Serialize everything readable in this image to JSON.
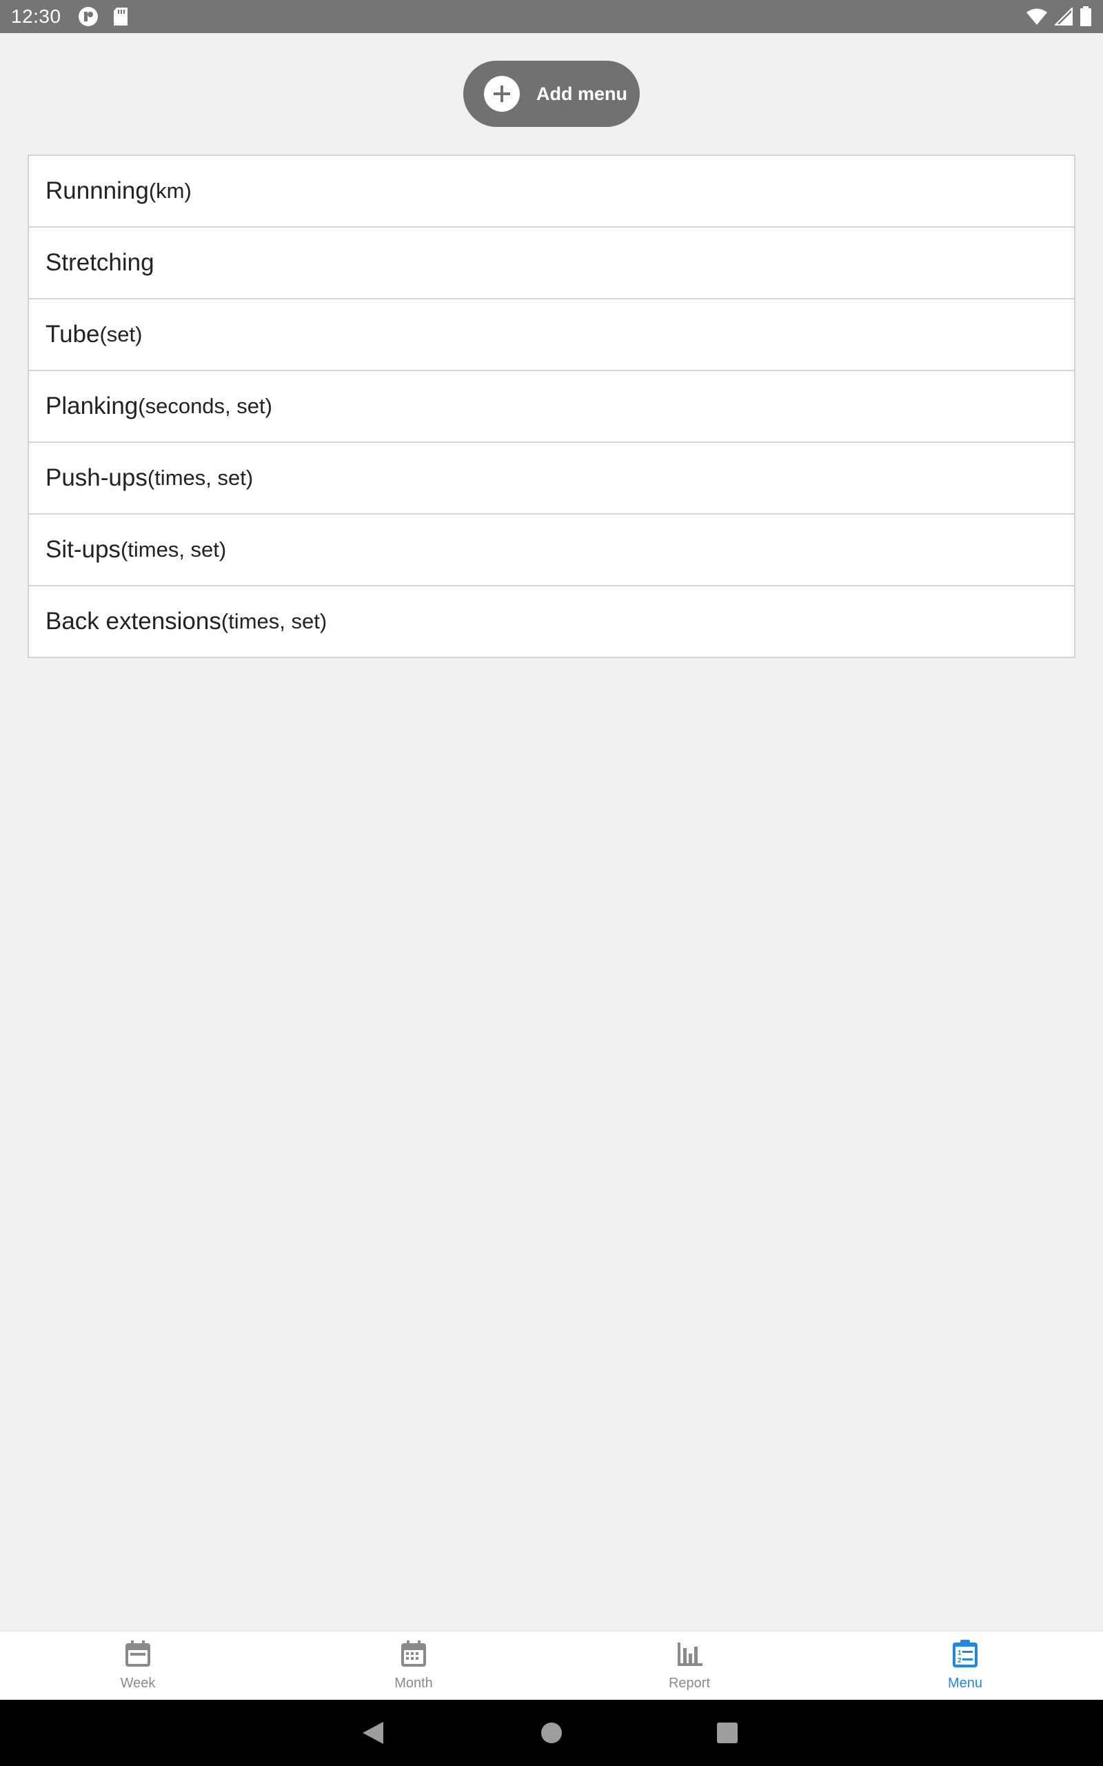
{
  "status_bar": {
    "time": "12:30"
  },
  "add_menu": {
    "label": "Add menu"
  },
  "exercises": [
    {
      "name": "Runnning",
      "unit": "(km)"
    },
    {
      "name": "Stretching",
      "unit": ""
    },
    {
      "name": "Tube",
      "unit": "(set)"
    },
    {
      "name": "Planking",
      "unit": "(seconds, set)"
    },
    {
      "name": "Push-ups",
      "unit": "(times, set)"
    },
    {
      "name": "Sit-ups",
      "unit": "(times, set)"
    },
    {
      "name": "Back extensions",
      "unit": "(times, set)"
    }
  ],
  "bottom_nav": {
    "active": "Menu",
    "active_color": "#1e88e5",
    "inactive_color": "#8a8a8a",
    "tabs": [
      {
        "label": "Week",
        "icon": "calendar-week-icon"
      },
      {
        "label": "Month",
        "icon": "calendar-month-icon"
      },
      {
        "label": "Report",
        "icon": "bar-chart-icon"
      },
      {
        "label": "Menu",
        "icon": "clipboard-list-icon"
      }
    ]
  }
}
